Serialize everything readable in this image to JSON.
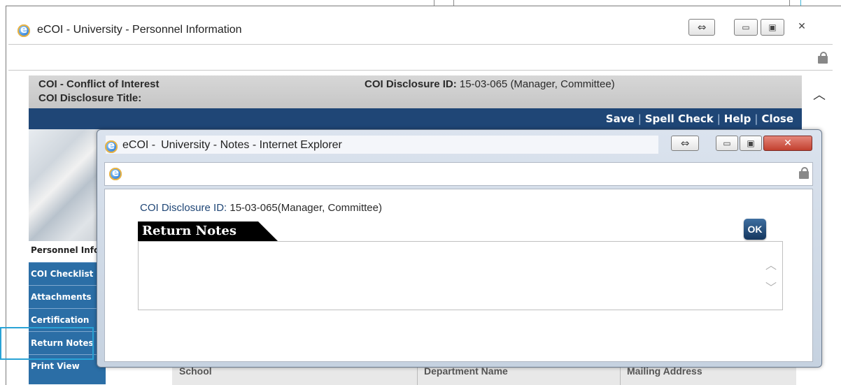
{
  "outer_window": {
    "title": "eCOI - University - Personnel Information",
    "controls": {
      "resize": "⇔",
      "minimize": "▭",
      "maximize": "▣",
      "close": "✕"
    }
  },
  "coi_header": {
    "line1": "COI - Conflict of Interest",
    "line2": "COI Disclosure Title:",
    "id_label": "COI Disclosure ID:",
    "id_value": "15-03-065",
    "id_roles": "(Manager, Committee)"
  },
  "action_links": [
    "Save",
    "Spell Check",
    "Help",
    "Close"
  ],
  "sidebar": {
    "header": "Personnel Info",
    "items": [
      {
        "label": "COI Checklist"
      },
      {
        "label": "Attachments"
      },
      {
        "label": "Certification"
      },
      {
        "label": "Return Notes"
      },
      {
        "label": "Print View"
      }
    ]
  },
  "bottom_table": {
    "headers": [
      "School",
      "Department Name",
      "Mailing Address"
    ]
  },
  "notes_window": {
    "title_prefix": "eCOI -",
    "title_suffix": "University - Notes - Internet Explorer",
    "id_label": "COI Disclosure ID:",
    "id_value": "15-03-065",
    "id_roles": "(Manager, Committee)",
    "section_title": "Return Notes",
    "ok_label": "OK",
    "notes_text": ""
  },
  "colors": {
    "navy": "#1f4676",
    "sidebar_blue": "#2b6ea6",
    "highlight": "#29a3d6"
  }
}
